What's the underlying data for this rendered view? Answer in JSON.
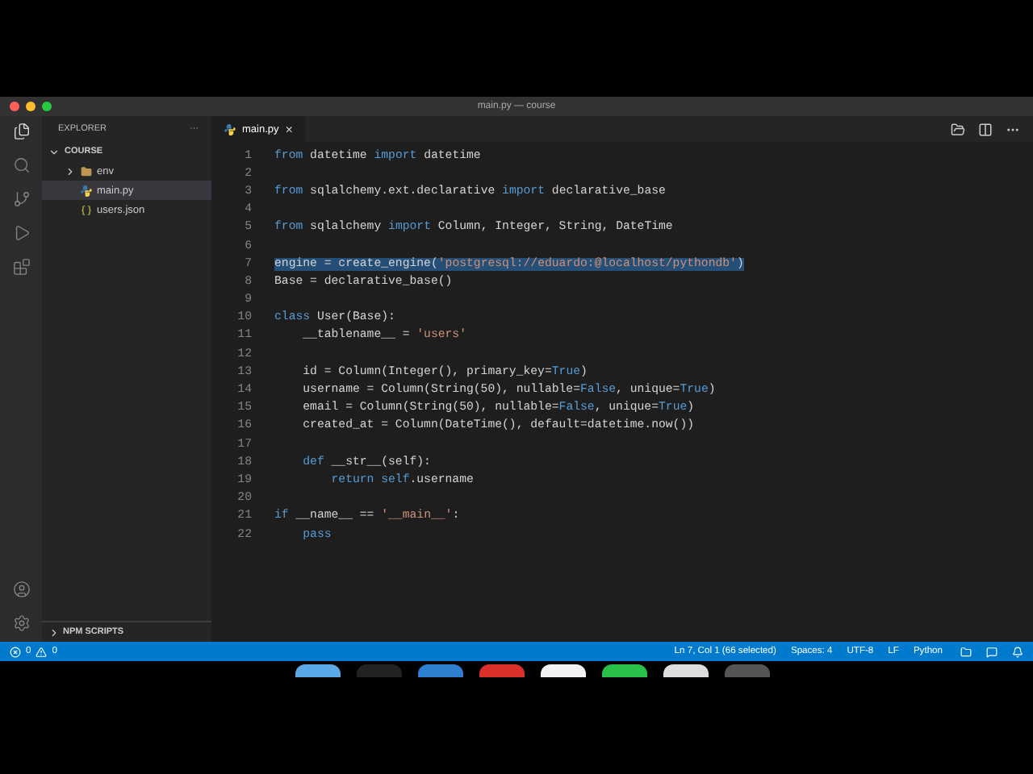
{
  "window": {
    "title": "main.py — course"
  },
  "sidebar": {
    "title": "EXPLORER",
    "more": "···",
    "tree": [
      {
        "label": "COURSE",
        "kind": "root",
        "expanded": true,
        "children": [
          {
            "label": "env",
            "kind": "folder",
            "expanded": false,
            "selected": false
          },
          {
            "label": "main.py",
            "kind": "python",
            "selected": true
          },
          {
            "label": "users.json",
            "kind": "json",
            "selected": false
          }
        ]
      }
    ],
    "footer_section": {
      "label": "NPM SCRIPTS",
      "expanded": false
    }
  },
  "tabs": [
    {
      "label": "main.py",
      "selected": true,
      "close": "×"
    }
  ],
  "editor": {
    "lines": [
      {
        "number": "1",
        "selected": false,
        "tokens": [
          {
            "kind": "kw",
            "text": "from"
          },
          {
            "kind": "text",
            "text": " datetime "
          },
          {
            "kind": "kw",
            "text": "import"
          },
          {
            "kind": "text",
            "text": " datetime"
          }
        ]
      },
      {
        "number": "2"
      },
      {
        "number": "3",
        "selected": false,
        "tokens": [
          {
            "kind": "kw",
            "text": "from"
          },
          {
            "kind": "text",
            "text": " sqlalchemy.ext.declarative "
          },
          {
            "kind": "kw",
            "text": "import"
          },
          {
            "kind": "text",
            "text": " declarative_base"
          }
        ]
      },
      {
        "number": "4"
      },
      {
        "number": "5",
        "selected": false,
        "tokens": [
          {
            "kind": "kw",
            "text": "from"
          },
          {
            "kind": "text",
            "text": " sqlalchemy "
          },
          {
            "kind": "kw",
            "text": "import"
          },
          {
            "kind": "text",
            "text": " Column, Integer, String, DateTime"
          }
        ]
      },
      {
        "number": "6"
      },
      {
        "number": "7",
        "selected": true,
        "tokens": [
          {
            "kind": "text",
            "text": "engine = create_engine("
          },
          {
            "kind": "str",
            "text": "'postgresql://eduardo:@localhost/pythondb'"
          },
          {
            "kind": "text",
            "text": ")"
          }
        ]
      },
      {
        "number": "8",
        "selected": false,
        "tokens": [
          {
            "kind": "text",
            "text": "Base = declarative_base()"
          }
        ]
      },
      {
        "number": "9"
      },
      {
        "number": "10",
        "selected": false,
        "tokens": [
          {
            "kind": "kw",
            "text": "class"
          },
          {
            "kind": "text",
            "text": " User(Base):"
          }
        ]
      },
      {
        "number": "11",
        "selected": false,
        "tokens": [
          {
            "kind": "text",
            "text": "    __tablename__ = "
          },
          {
            "kind": "str",
            "text": "'users'"
          }
        ]
      },
      {
        "number": "12"
      },
      {
        "number": "13",
        "selected": false,
        "tokens": [
          {
            "kind": "text",
            "text": "    id = Column(Integer(), primary_key="
          },
          {
            "kind": "kw",
            "text": "True"
          },
          {
            "kind": "text",
            "text": ")"
          }
        ]
      },
      {
        "number": "14",
        "selected": false,
        "tokens": [
          {
            "kind": "text",
            "text": "    username = Column(String(50), nullable="
          },
          {
            "kind": "kw",
            "text": "False"
          },
          {
            "kind": "text",
            "text": ", unique="
          },
          {
            "kind": "kw",
            "text": "True"
          },
          {
            "kind": "text",
            "text": ")"
          }
        ]
      },
      {
        "number": "15",
        "selected": false,
        "tokens": [
          {
            "kind": "text",
            "text": "    email = Column(String(50), nullable="
          },
          {
            "kind": "kw",
            "text": "False"
          },
          {
            "kind": "text",
            "text": ", unique="
          },
          {
            "kind": "kw",
            "text": "True"
          },
          {
            "kind": "text",
            "text": ")"
          }
        ]
      },
      {
        "number": "16",
        "selected": false,
        "tokens": [
          {
            "kind": "text",
            "text": "    created_at = Column(DateTime(), default=datetime.now())"
          }
        ]
      },
      {
        "number": "17"
      },
      {
        "number": "18",
        "selected": false,
        "tokens": [
          {
            "kind": "kw",
            "text": "    def"
          },
          {
            "kind": "text",
            "text": " __str__(self):"
          }
        ]
      },
      {
        "number": "19",
        "selected": false,
        "tokens": [
          {
            "kind": "kw",
            "text": "        return self"
          },
          {
            "kind": "text",
            "text": ".username"
          }
        ]
      },
      {
        "number": "20"
      },
      {
        "number": "21",
        "selected": false,
        "tokens": [
          {
            "kind": "kw",
            "text": "if"
          },
          {
            "kind": "text",
            "text": " __name__ == "
          },
          {
            "kind": "str",
            "text": "'__main__'"
          },
          {
            "kind": "text",
            "text": ":"
          }
        ]
      },
      {
        "number": "22",
        "selected": false,
        "tokens": [
          {
            "kind": "kw",
            "text": "    pass"
          }
        ]
      }
    ]
  },
  "status_bar": {
    "errors": "0",
    "warnings": "0",
    "items": [
      "Ln 7, Col 1 (66 selected)",
      "Spaces: 4",
      "UTF-8",
      "LF",
      "Python"
    ]
  }
}
